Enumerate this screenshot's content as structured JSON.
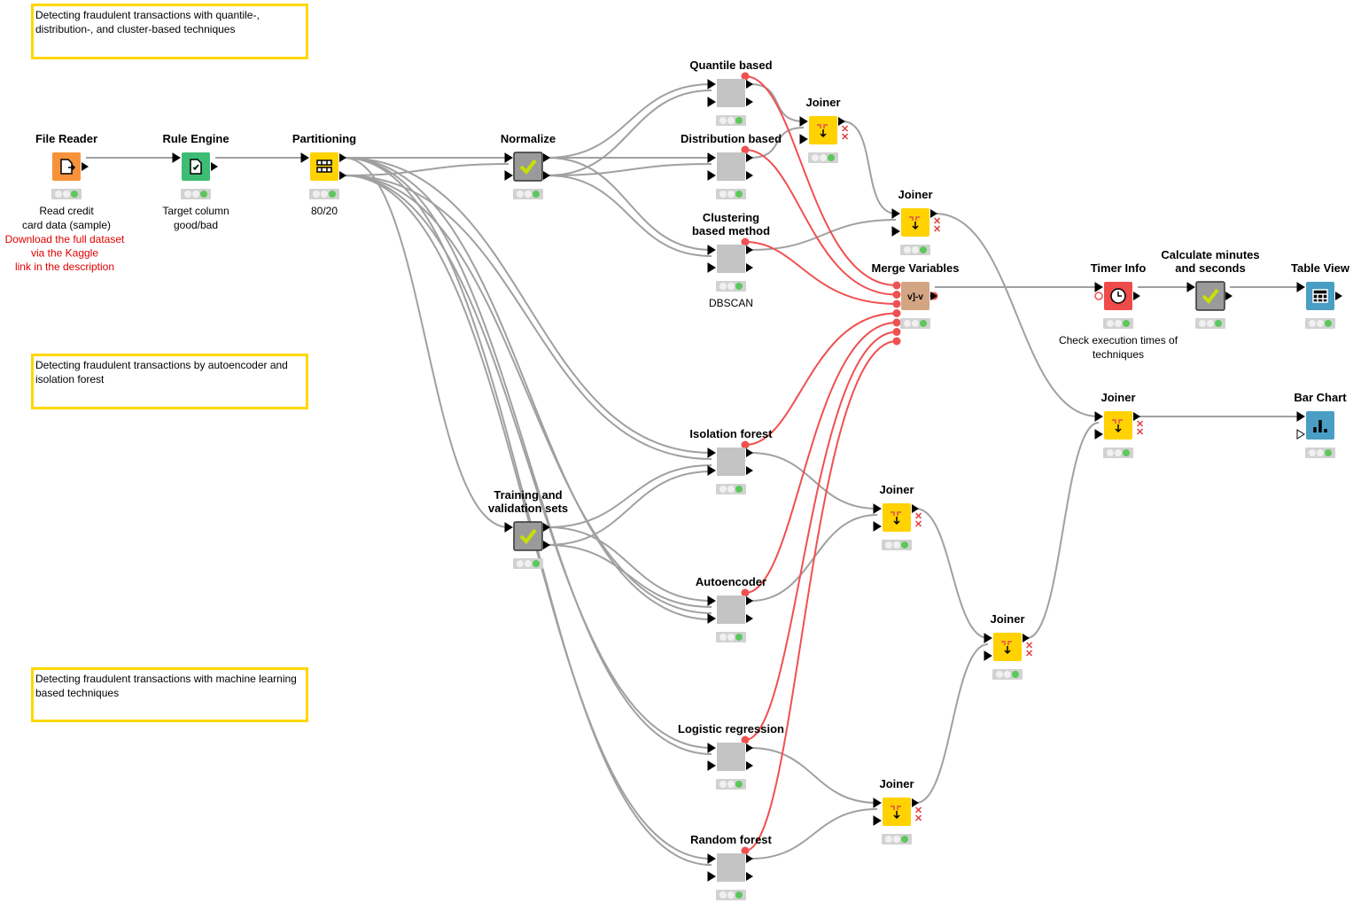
{
  "annotations": [
    {
      "id": "anno-1",
      "text": "Detecting fraudulent transactions with quantile-, distribution-, and cluster-based techniques"
    },
    {
      "id": "anno-2",
      "text": "Detecting fraudulent transactions by autoencoder and isolation forest"
    },
    {
      "id": "anno-3",
      "text": "Detecting fraudulent transactions with machine learning  based techniques"
    }
  ],
  "colors": {
    "annotation_border": "#ffd700",
    "connection": "#a0a0a0",
    "flow_variable": "#f05050",
    "status_green": "#5cc85c"
  },
  "nodes": [
    {
      "id": "file-reader",
      "title": "File Reader",
      "type": "source",
      "icon": "file-reader-icon",
      "color": "#f7923a",
      "sub": [
        "Read credit",
        "card data (sample)"
      ],
      "sub_red": [
        "Download the full dataset",
        "via the Kaggle",
        "link in the description"
      ]
    },
    {
      "id": "rule-engine",
      "title": "Rule Engine",
      "type": "manipulator",
      "icon": "rule-document-icon",
      "color": "#3dbd74",
      "sub": [
        "Target column",
        "good/bad"
      ]
    },
    {
      "id": "partitioning",
      "title": "Partitioning",
      "type": "manipulator",
      "icon": "partition-grid-icon",
      "color": "#ffd200",
      "sub": [
        "80/20"
      ]
    },
    {
      "id": "normalize",
      "title": "Normalize",
      "type": "component",
      "icon": "check-icon",
      "color": "#9a9a9a",
      "sub": []
    },
    {
      "id": "quantile",
      "title": "Quantile based",
      "type": "metanode",
      "icon": "",
      "color": "#c4c4c4",
      "sub": []
    },
    {
      "id": "distribution",
      "title": "Distribution based",
      "type": "metanode",
      "icon": "",
      "color": "#c4c4c4",
      "sub": []
    },
    {
      "id": "clustering",
      "title": "Clustering\nbased method",
      "type": "metanode",
      "icon": "",
      "color": "#c4c4c4",
      "sub": [
        "DBSCAN"
      ]
    },
    {
      "id": "joiner-1",
      "title": "Joiner",
      "type": "manipulator",
      "icon": "joiner-icon",
      "color": "#ffd200",
      "sub": []
    },
    {
      "id": "joiner-2",
      "title": "Joiner",
      "type": "manipulator",
      "icon": "joiner-icon",
      "color": "#ffd200",
      "sub": []
    },
    {
      "id": "merge-variables",
      "title": "Merge Variables",
      "type": "flow",
      "icon": "merge-variables-icon",
      "color": "#d4a583",
      "sub": []
    },
    {
      "id": "timer-info",
      "title": "Timer Info",
      "type": "other",
      "icon": "clock-icon",
      "color": "#f04b4b",
      "sub": [
        "Check execution times of",
        "techniques"
      ]
    },
    {
      "id": "calc-minutes",
      "title": "Calculate minutes\nand seconds",
      "type": "component",
      "icon": "check-icon",
      "color": "#9a9a9a",
      "sub": []
    },
    {
      "id": "table-view",
      "title": "Table View",
      "type": "view",
      "icon": "table-icon",
      "color": "#4a9ec4",
      "sub": []
    },
    {
      "id": "joiner-3",
      "title": "Joiner",
      "type": "manipulator",
      "icon": "joiner-icon",
      "color": "#ffd200",
      "sub": []
    },
    {
      "id": "bar-chart",
      "title": "Bar Chart",
      "type": "view",
      "icon": "bar-chart-icon",
      "color": "#4a9ec4",
      "sub": []
    },
    {
      "id": "isolation-forest",
      "title": "Isolation forest",
      "type": "metanode",
      "icon": "",
      "color": "#c4c4c4",
      "sub": []
    },
    {
      "id": "training-sets",
      "title": "Training and\nvalidation sets",
      "type": "component",
      "icon": "check-icon",
      "color": "#9a9a9a",
      "sub": []
    },
    {
      "id": "joiner-4",
      "title": "Joiner",
      "type": "manipulator",
      "icon": "joiner-icon",
      "color": "#ffd200",
      "sub": []
    },
    {
      "id": "autoencoder",
      "title": "Autoencoder",
      "type": "metanode",
      "icon": "",
      "color": "#c4c4c4",
      "sub": []
    },
    {
      "id": "joiner-5",
      "title": "Joiner",
      "type": "manipulator",
      "icon": "joiner-icon",
      "color": "#ffd200",
      "sub": []
    },
    {
      "id": "logistic-regression",
      "title": "Logistic regression",
      "type": "metanode",
      "icon": "",
      "color": "#c4c4c4",
      "sub": []
    },
    {
      "id": "joiner-6",
      "title": "Joiner",
      "type": "manipulator",
      "icon": "joiner-icon",
      "color": "#ffd200",
      "sub": []
    },
    {
      "id": "random-forest",
      "title": "Random forest",
      "type": "metanode",
      "icon": "",
      "color": "#c4c4c4",
      "sub": []
    }
  ],
  "connections": [
    [
      "file-reader",
      "rule-engine"
    ],
    [
      "rule-engine",
      "partitioning"
    ],
    [
      "partitioning",
      "normalize"
    ],
    [
      "partitioning",
      "normalize"
    ],
    [
      "normalize",
      "quantile"
    ],
    [
      "normalize",
      "quantile"
    ],
    [
      "normalize",
      "distribution"
    ],
    [
      "normalize",
      "distribution"
    ],
    [
      "normalize",
      "clustering"
    ],
    [
      "normalize",
      "clustering"
    ],
    [
      "quantile",
      "joiner-1"
    ],
    [
      "distribution",
      "joiner-1"
    ],
    [
      "joiner-1",
      "joiner-2"
    ],
    [
      "clustering",
      "joiner-2"
    ],
    [
      "joiner-2",
      "joiner-3"
    ],
    [
      "joiner-5",
      "joiner-3"
    ],
    [
      "joiner-3",
      "bar-chart"
    ],
    [
      "partitioning",
      "isolation-forest"
    ],
    [
      "partitioning",
      "isolation-forest"
    ],
    [
      "partitioning",
      "training-sets"
    ],
    [
      "training-sets",
      "isolation-forest"
    ],
    [
      "training-sets",
      "isolation-forest"
    ],
    [
      "training-sets",
      "autoencoder"
    ],
    [
      "training-sets",
      "autoencoder"
    ],
    [
      "partitioning",
      "autoencoder"
    ],
    [
      "partitioning",
      "autoencoder"
    ],
    [
      "isolation-forest",
      "joiner-4"
    ],
    [
      "autoencoder",
      "joiner-4"
    ],
    [
      "joiner-4",
      "joiner-5"
    ],
    [
      "joiner-6",
      "joiner-5"
    ],
    [
      "partitioning",
      "logistic-regression"
    ],
    [
      "partitioning",
      "logistic-regression"
    ],
    [
      "partitioning",
      "random-forest"
    ],
    [
      "partitioning",
      "random-forest"
    ],
    [
      "logistic-regression",
      "joiner-6"
    ],
    [
      "random-forest",
      "joiner-6"
    ],
    [
      "merge-variables",
      "timer-info"
    ],
    [
      "timer-info",
      "calc-minutes"
    ],
    [
      "calc-minutes",
      "table-view"
    ]
  ],
  "flow_connections": [
    "quantile",
    "distribution",
    "clustering",
    "isolation-forest",
    "autoencoder",
    "logistic-regression",
    "random-forest"
  ]
}
